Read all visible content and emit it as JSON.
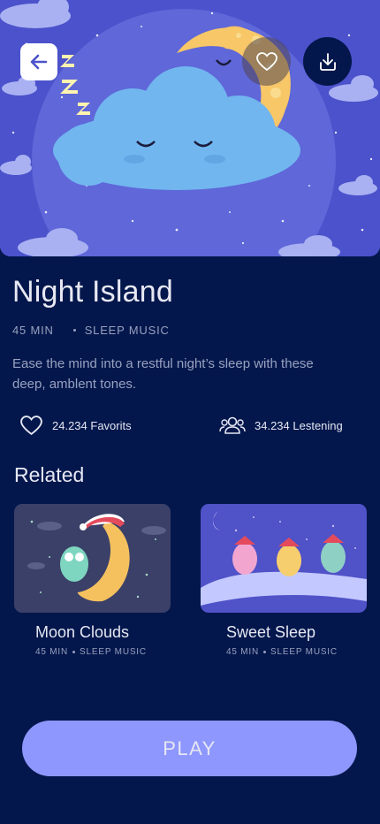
{
  "track": {
    "title": "Night Island",
    "duration": "45 MIN",
    "category": "SLEEP MUSIC",
    "description": "Ease the mind into a restful night’s sleep  with these deep, amblent tones."
  },
  "stats": {
    "favorites": "24.234 Favorits",
    "listening": "34.234 Lestening"
  },
  "related": {
    "heading": "Related",
    "items": [
      {
        "title": "Moon Clouds",
        "duration": "45 MIN",
        "category": "SLEEP MUSIC"
      },
      {
        "title": "Sweet Sleep",
        "duration": "45 MIN",
        "category": "SLEEP MUSIC"
      }
    ]
  },
  "actions": {
    "play_label": "PLAY"
  },
  "icons": {
    "back": "arrow-left-icon",
    "favorite": "heart-icon",
    "download": "download-icon",
    "favorites_stat": "heart-icon",
    "listeners_stat": "people-icon"
  },
  "colors": {
    "background": "#03174c",
    "accent": "#8e97fd",
    "text": "#e6e7f2",
    "muted": "#98a1bf"
  }
}
